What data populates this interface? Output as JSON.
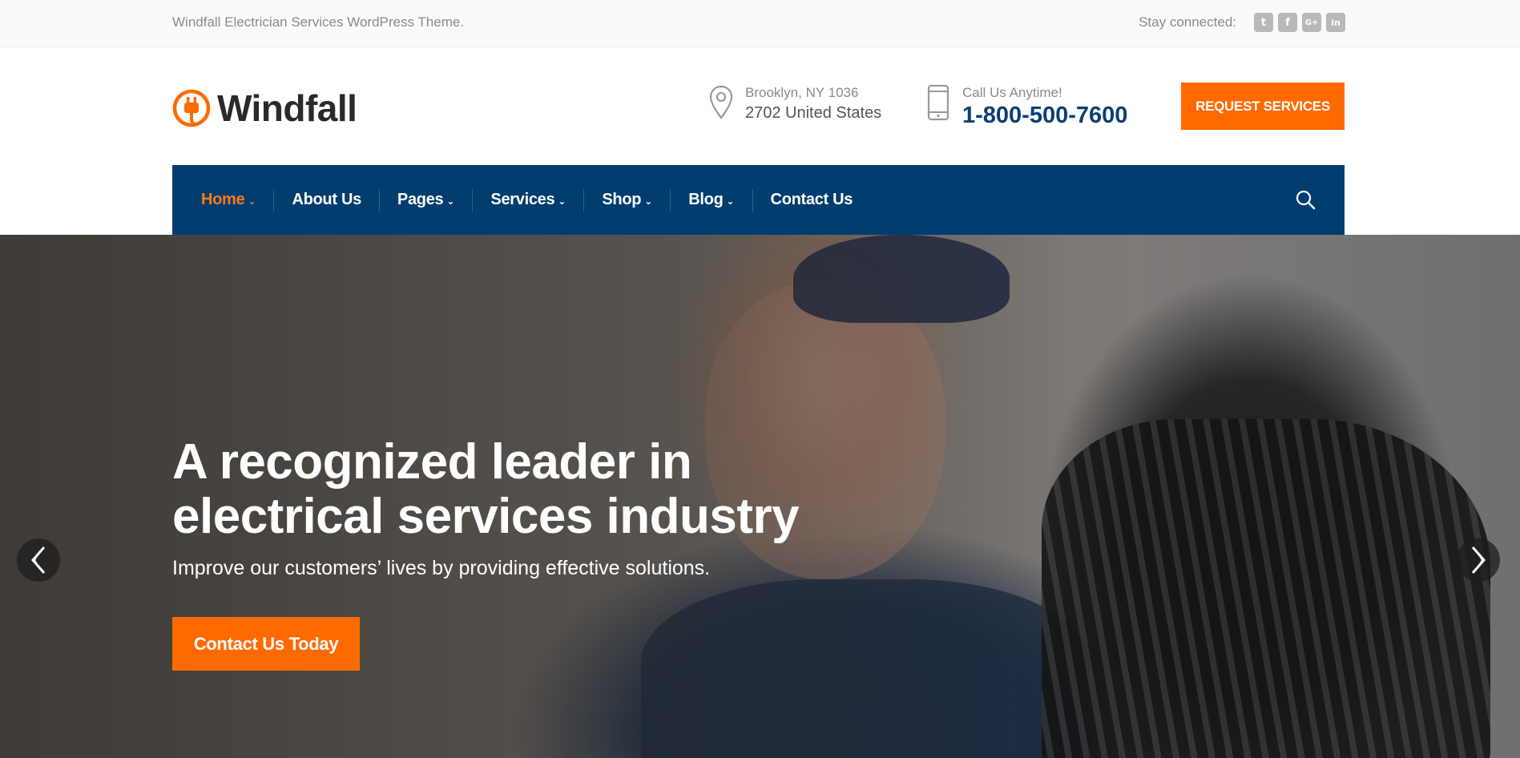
{
  "topbar": {
    "tagline": "Windfall Electrician Services WordPress Theme.",
    "social_label": "Stay connected:",
    "social": [
      {
        "icon": "twitter-icon",
        "glyph": "t"
      },
      {
        "icon": "facebook-icon",
        "glyph": "f"
      },
      {
        "icon": "google-plus-icon",
        "glyph": "G+"
      },
      {
        "icon": "linkedin-icon",
        "glyph": "in"
      }
    ]
  },
  "header": {
    "logo_text": "Windfall",
    "address_line1": "Brooklyn, NY 1036",
    "address_line2": "2702 United States",
    "call_label": "Call Us Anytime!",
    "phone": "1-800-500-7600",
    "request_button": "REQUEST SERVICES"
  },
  "nav": {
    "items": [
      {
        "label": "Home",
        "dropdown": true,
        "active": true
      },
      {
        "label": "About Us",
        "dropdown": false,
        "active": false
      },
      {
        "label": "Pages",
        "dropdown": true,
        "active": false
      },
      {
        "label": "Services",
        "dropdown": true,
        "active": false
      },
      {
        "label": "Shop",
        "dropdown": true,
        "active": false
      },
      {
        "label": "Blog",
        "dropdown": true,
        "active": false
      },
      {
        "label": "Contact Us",
        "dropdown": false,
        "active": false
      }
    ],
    "chevron": "⌄"
  },
  "hero": {
    "headline": "A recognized leader in electrical services industry",
    "subtitle": "Improve our customers’ lives by providing effective solutions.",
    "cta": "Contact Us Today"
  },
  "colors": {
    "accent": "#ff6a00",
    "nav_bg": "#023d6f",
    "phone": "#0a3f73"
  }
}
